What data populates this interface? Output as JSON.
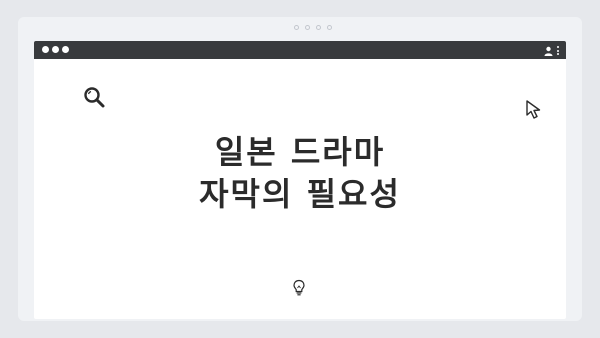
{
  "headline": {
    "line1": "일본 드라마",
    "line2": "자막의 필요성"
  },
  "icons": {
    "search": "search-icon",
    "cursor": "cursor-arrow-icon",
    "lightbulb": "lightbulb-icon",
    "profile": "profile-icon",
    "menu": "more-vert-icon"
  },
  "colors": {
    "titlebar": "#383a3d",
    "page_background": "#ffffff",
    "frame_background": "#f0f2f5",
    "text": "#2b2b2b"
  }
}
